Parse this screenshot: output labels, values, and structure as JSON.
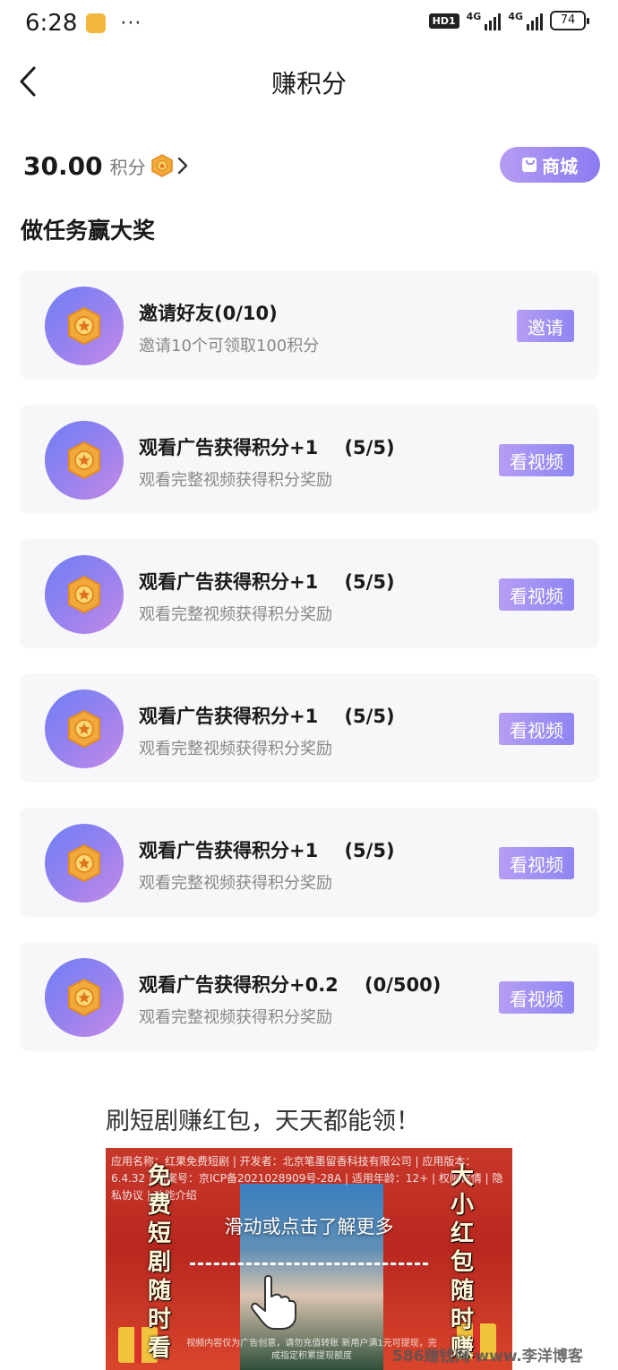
{
  "status_bar": {
    "time": "6:28",
    "dots": "···",
    "hd_label": "HD1",
    "network_1": "4G",
    "network_2": "4G",
    "battery": "74"
  },
  "header": {
    "title": "赚积分"
  },
  "points": {
    "value": "30.00",
    "unit": "积分"
  },
  "mall_button": {
    "label": "商城"
  },
  "section": {
    "title": "做任务赢大奖"
  },
  "tasks": [
    {
      "title": "邀请好友(0/10)",
      "desc": "邀请10个可领取100积分",
      "button": "邀请"
    },
    {
      "title": "观看广告获得积分+1    (5/5)",
      "desc": "观看完整视频获得积分奖励",
      "button": "看视频"
    },
    {
      "title": "观看广告获得积分+1    (5/5)",
      "desc": "观看完整视频获得积分奖励",
      "button": "看视频"
    },
    {
      "title": "观看广告获得积分+1    (5/5)",
      "desc": "观看完整视频获得积分奖励",
      "button": "看视频"
    },
    {
      "title": "观看广告获得积分+1    (5/5)",
      "desc": "观看完整视频获得积分奖励",
      "button": "看视频"
    },
    {
      "title": "观看广告获得积分+0.2    (0/500)",
      "desc": "观看完整视频获得积分奖励",
      "button": "看视频"
    }
  ],
  "promo": {
    "heading": "刷短剧赚红包，天天都能领！",
    "info": "应用名称：红果免费短剧 | 开发者：北京笔墨留香科技有限公司 | 应用版本：6.4.32 | 备案号：京ICP备2021028909号-28A | 适用年龄：12+ | 权限详情 | 隐私协议 | 功能介绍",
    "left_vertical": "免费短剧随时看",
    "right_vertical": "大小红包随时赚",
    "cta": "滑动或点击了解更多",
    "disclaimer": "视频内容仅为广告创意，请勿充值转账 新用户满1元可提现，完成指定积累提现额度"
  },
  "watermark": "586赚钱网 www.李洋博客",
  "colors": {
    "accent_start": "#b69df4",
    "accent_end": "#8e86f2",
    "card_bg": "#f7f7f9",
    "icon_gradient_start": "#6e7ff5",
    "icon_gradient_end": "#c58ae6",
    "coin": "#f2a93b"
  }
}
